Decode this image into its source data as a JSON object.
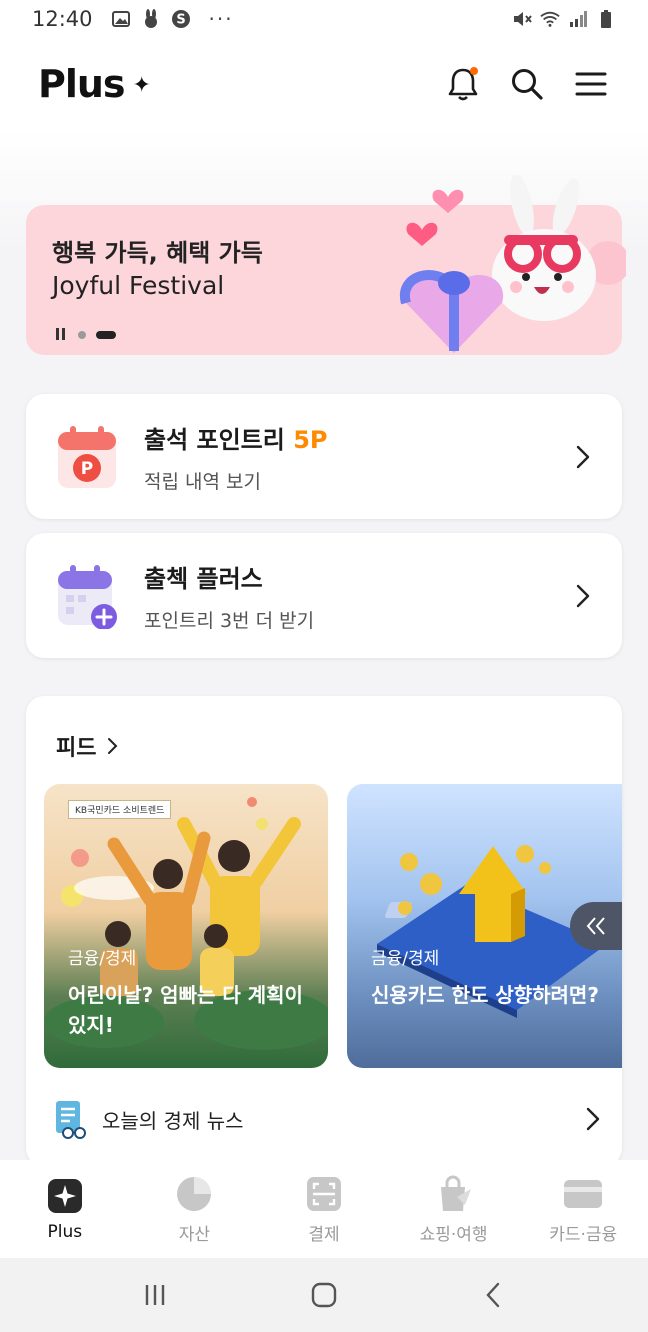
{
  "status_bar": {
    "time": "12:40",
    "more": "···"
  },
  "header": {
    "logo": "Plus",
    "logo_mark": "✦"
  },
  "banner": {
    "title": "행복 가득, 혜택 가득",
    "subtitle": "Joyful Festival",
    "colors": {
      "background": "#fdd6dc"
    }
  },
  "attendance": {
    "title": "출석 포인트리",
    "points": "5P",
    "subtitle": "적립 내역 보기",
    "icon": "calendar-p-icon",
    "accent": "#ff8a00"
  },
  "checkin": {
    "title": "출첵 플러스",
    "subtitle": "포인트리 3번 더 받기",
    "icon": "calendar-plus-icon"
  },
  "feed": {
    "title": "피드",
    "tiles": [
      {
        "category": "금융/경제",
        "title": "어린이날? 엄빠는 다 계획이 있지!",
        "badge": "KB국민카드 소비트렌드"
      },
      {
        "category": "금융/경제",
        "title": "신용카드 한도 상향하려면?"
      }
    ],
    "news": {
      "label": "오늘의 경제 뉴스",
      "icon": "news-doc-icon"
    }
  },
  "bottom_nav": {
    "items": [
      {
        "label": "Plus",
        "icon": "plus-star-icon",
        "active": true
      },
      {
        "label": "자산",
        "icon": "pie-chart-icon",
        "active": false
      },
      {
        "label": "결제",
        "icon": "scan-icon",
        "active": false
      },
      {
        "label": "쇼핑·여행",
        "icon": "shopping-bag-icon",
        "active": false
      },
      {
        "label": "카드·금융",
        "icon": "card-icon",
        "active": false
      }
    ]
  }
}
